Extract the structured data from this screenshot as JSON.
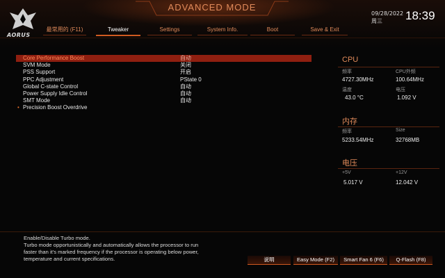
{
  "header": {
    "logo_text": "AORUS",
    "mode_title": "ADVANCED MODE",
    "date": "09/28/2022",
    "weekday": "周三",
    "time": "18:39"
  },
  "tabs": [
    {
      "label": "最常用的 (F11)",
      "active": false
    },
    {
      "label": "Tweaker",
      "active": true
    },
    {
      "label": "Settings",
      "active": false
    },
    {
      "label": "System Info.",
      "active": false
    },
    {
      "label": "Boot",
      "active": false
    },
    {
      "label": "Save & Exit",
      "active": false
    }
  ],
  "settings": [
    {
      "name": "Core Performance Boost",
      "value": "自动",
      "selected": true
    },
    {
      "name": "SVM Mode",
      "value": "关闭"
    },
    {
      "name": "PSS Support",
      "value": "开启"
    },
    {
      "name": "PPC Adjustment",
      "value": "PState 0"
    },
    {
      "name": "Global C-state Control",
      "value": "自动"
    },
    {
      "name": "Power Supply Idle Control",
      "value": "自动"
    },
    {
      "name": "SMT Mode",
      "value": "自动"
    },
    {
      "name": "Precision Boost Overdrive",
      "value": "",
      "submenu": true
    }
  ],
  "panel": {
    "cpu": {
      "title": "CPU",
      "freq_label": "频率",
      "freq": "4727.30MHz",
      "ext_label": "CPU外频",
      "ext": "100.64MHz",
      "temp_label": "温度",
      "temp": "43.0 °C",
      "volt_label": "电压",
      "volt": "1.092 V"
    },
    "mem": {
      "title": "内存",
      "freq_label": "频率",
      "freq": "5233.54MHz",
      "size_label": "Size",
      "size": "32768MB"
    },
    "voltage": {
      "title": "电压",
      "v5_label": "+5V",
      "v5": "5.017 V",
      "v12_label": "+12V",
      "v12": "12.042 V"
    }
  },
  "help": {
    "line1": "Enable/Disable Turbo mode.",
    "line2": "Turbo mode opportunistically and automatically allows the processor to run",
    "line3": "faster than it's marked frequency if the processor is operating below power,",
    "line4": "temperature and current specifications."
  },
  "buttons": {
    "help": "说明",
    "easy_mode": "Easy Mode (F2)",
    "smart_fan": "Smart Fan 6 (F6)",
    "qflash": "Q-Flash (F8)"
  },
  "colors": {
    "accent": "#e08a5a",
    "selected_row": "#8f1f10",
    "button_edge": "#d05a20"
  }
}
